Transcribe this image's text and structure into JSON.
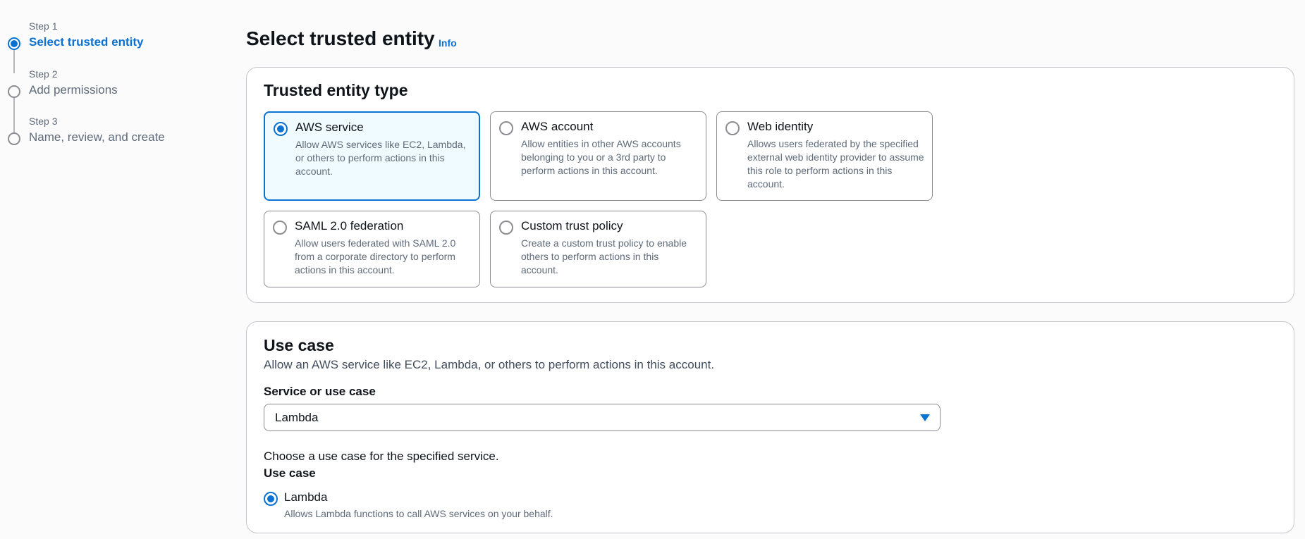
{
  "stepper": {
    "steps": [
      {
        "number": "Step 1",
        "title": "Select trusted entity",
        "state": "active"
      },
      {
        "number": "Step 2",
        "title": "Add permissions",
        "state": "pending"
      },
      {
        "number": "Step 3",
        "title": "Name, review, and create",
        "state": "pending"
      }
    ]
  },
  "header": {
    "title": "Select trusted entity",
    "info_label": "Info"
  },
  "trusted_entity": {
    "title": "Trusted entity type",
    "options": [
      {
        "label": "AWS service",
        "description": "Allow AWS services like EC2, Lambda, or others to perform actions in this account.",
        "selected": true
      },
      {
        "label": "AWS account",
        "description": "Allow entities in other AWS accounts belonging to you or a 3rd party to perform actions in this account.",
        "selected": false
      },
      {
        "label": "Web identity",
        "description": "Allows users federated by the specified external web identity provider to assume this role to perform actions in this account.",
        "selected": false
      },
      {
        "label": "SAML 2.0 federation",
        "description": "Allow users federated with SAML 2.0 from a corporate directory to perform actions in this account.",
        "selected": false
      },
      {
        "label": "Custom trust policy",
        "description": "Create a custom trust policy to enable others to perform actions in this account.",
        "selected": false
      }
    ]
  },
  "use_case": {
    "title": "Use case",
    "description": "Allow an AWS service like EC2, Lambda, or others to perform actions in this account.",
    "service_label": "Service or use case",
    "service_value": "Lambda",
    "choose_text": "Choose a use case for the specified service.",
    "use_case_label": "Use case",
    "option": {
      "label": "Lambda",
      "description": "Allows Lambda functions to call AWS services on your behalf.",
      "selected": true
    }
  },
  "colors": {
    "accent": "#0972d3",
    "selected_tile_bg": "#f0fbff"
  },
  "icons": {
    "select_caret": "caret-down-icon",
    "active_step": "filled-circle-icon",
    "pending_step": "empty-circle-icon"
  }
}
